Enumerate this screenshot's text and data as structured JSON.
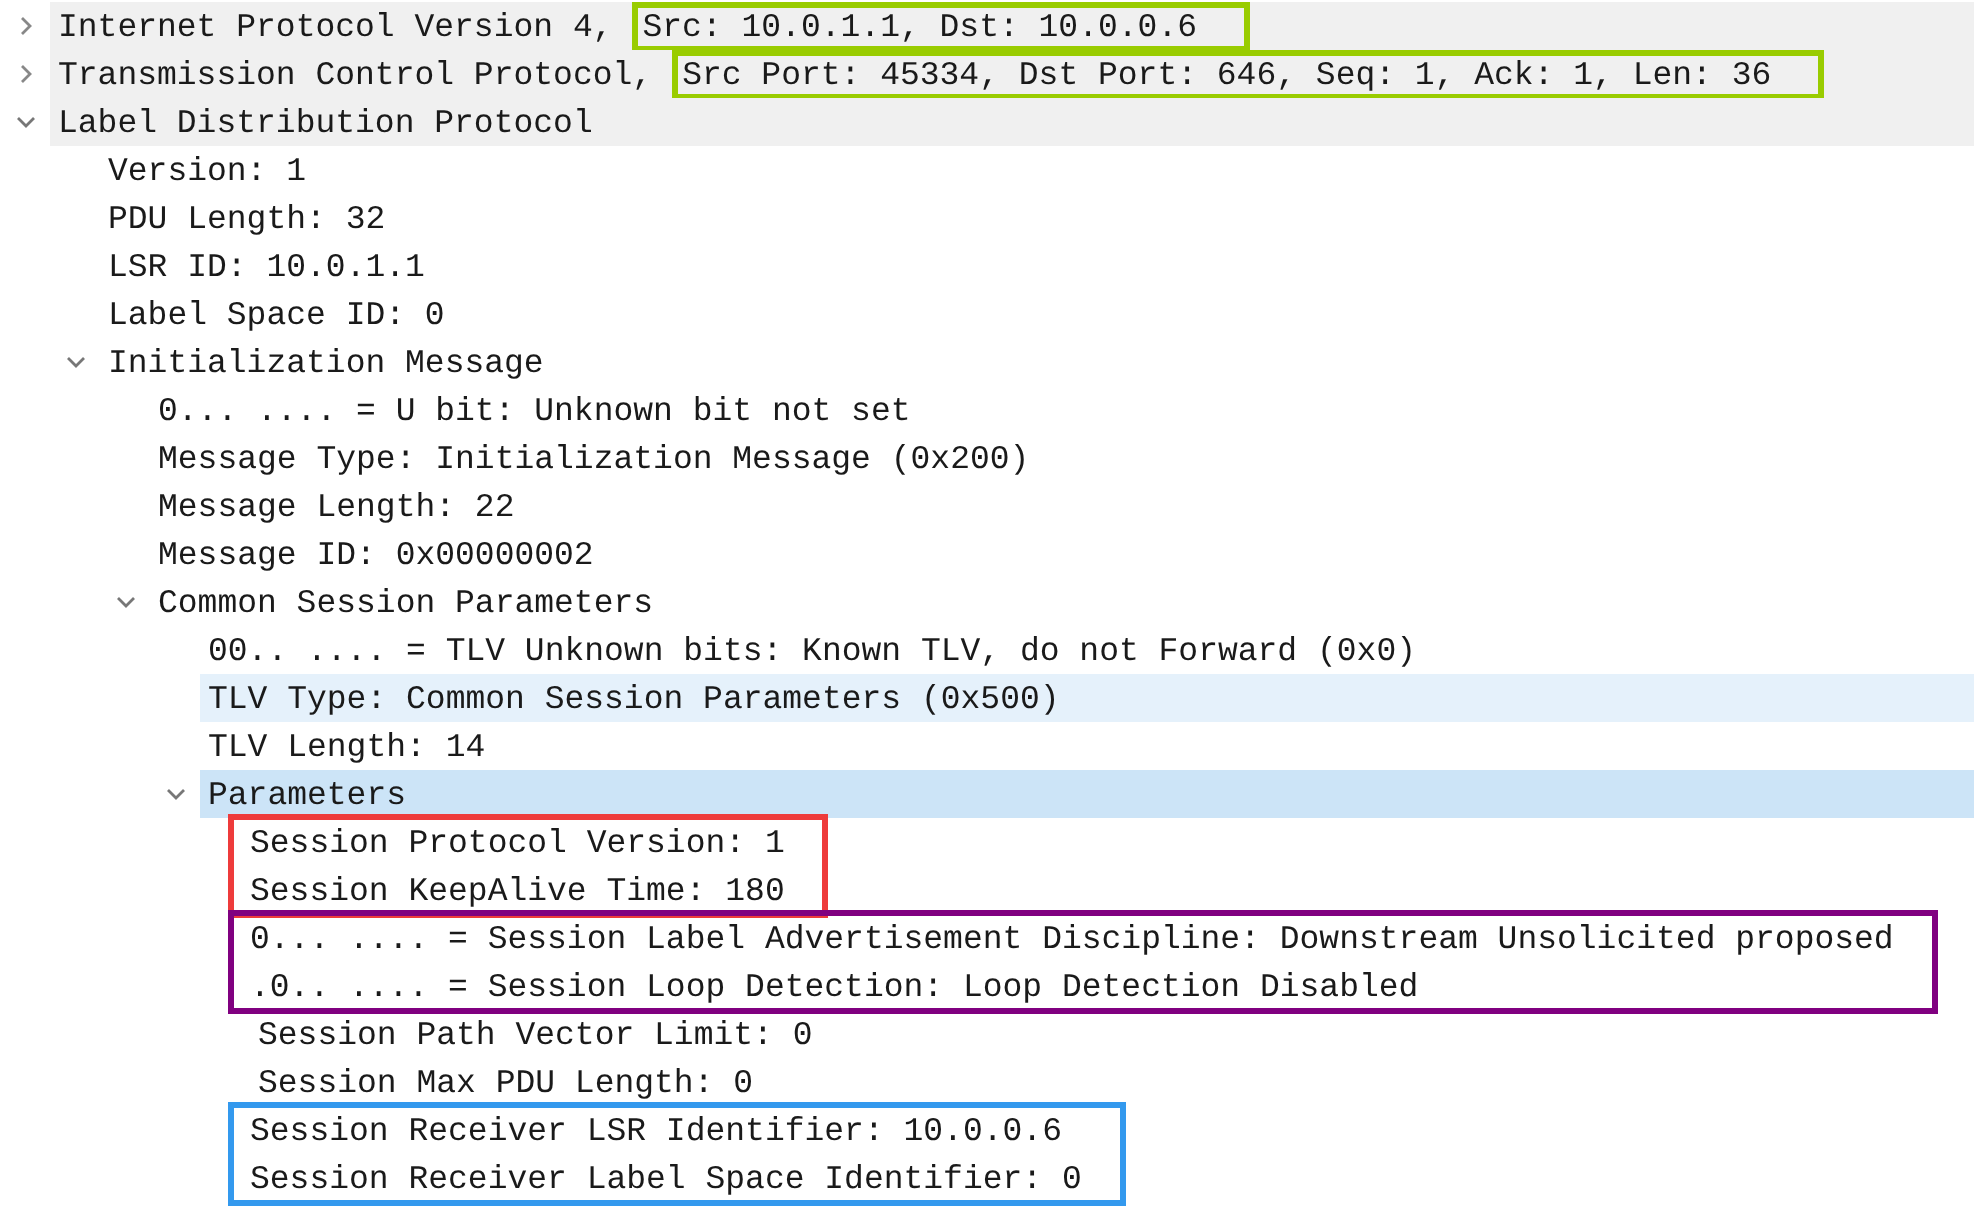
{
  "tree": [
    {
      "label": "Internet Protocol Version 4,",
      "detail": {
        "text": "Src: 10.0.1.1, Dst: 10.0.0.6",
        "color": "#99cc00"
      },
      "expanded": false,
      "selected": false,
      "hovered": false
    },
    {
      "label": "Transmission Control Protocol,",
      "detail": {
        "text": "Src Port: 45334, Dst Port: 646, Seq: 1, Ack: 1, Len: 36",
        "color": "#99cc00"
      },
      "expanded": false,
      "selected": false,
      "hovered": false
    },
    {
      "label": "Label Distribution Protocol",
      "expanded": true,
      "selected": false,
      "hovered": false,
      "children": [
        {
          "label": "Version: 1",
          "selected": false,
          "hovered": false
        },
        {
          "label": "PDU Length: 32",
          "selected": false,
          "hovered": false
        },
        {
          "label": "LSR ID: 10.0.1.1",
          "selected": false,
          "hovered": false
        },
        {
          "label": "Label Space ID: 0",
          "selected": false,
          "hovered": false
        },
        {
          "label": "Initialization Message",
          "expanded": true,
          "selected": false,
          "hovered": false,
          "children": [
            {
              "label": "0... .... = U bit: Unknown bit not set",
              "selected": false,
              "hovered": false
            },
            {
              "label": "Message Type: Initialization Message (0x200)",
              "selected": false,
              "hovered": false
            },
            {
              "label": "Message Length: 22",
              "selected": false,
              "hovered": false
            },
            {
              "label": "Message ID: 0x00000002",
              "selected": false,
              "hovered": false
            },
            {
              "label": "Common Session Parameters",
              "expanded": true,
              "selected": false,
              "hovered": false,
              "children": [
                {
                  "label": "00.. .... = TLV Unknown bits: Known TLV, do not Forward (0x0)",
                  "selected": false,
                  "hovered": false
                },
                {
                  "label": "TLV Type: Common Session Parameters (0x500)",
                  "selected": false,
                  "hovered": true
                },
                {
                  "label": "TLV Length: 14",
                  "selected": false,
                  "hovered": false
                },
                {
                  "label": "Parameters",
                  "expanded": true,
                  "selected": true,
                  "hovered": false,
                  "children": [
                    {
                      "label": "Session Protocol Version: 1",
                      "color": "#ee3b3b",
                      "selected": false,
                      "hovered": false
                    },
                    {
                      "label": "Session KeepAlive Time: 180",
                      "color": "#ee3b3b",
                      "selected": false,
                      "hovered": false
                    },
                    {
                      "label": "0... .... = Session Label Advertisement Discipline: Downstream Unsolicited proposed",
                      "color": "#800080",
                      "selected": false,
                      "hovered": false
                    },
                    {
                      "label": ".0.. .... = Session Loop Detection: Loop Detection Disabled",
                      "color": "#800080",
                      "selected": false,
                      "hovered": false
                    },
                    {
                      "label": "Session Path Vector Limit: 0",
                      "selected": false,
                      "hovered": false
                    },
                    {
                      "label": "Session Max PDU Length: 0",
                      "selected": false,
                      "hovered": false
                    },
                    {
                      "label": "Session Receiver LSR Identifier: 10.0.0.6",
                      "color": "#3399ee",
                      "selected": false,
                      "hovered": false
                    },
                    {
                      "label": "Session Receiver Label Space Identifier: 0",
                      "color": "#3399ee",
                      "selected": false,
                      "hovered": false
                    }
                  ]
                }
              ]
            }
          ]
        }
      ]
    }
  ]
}
